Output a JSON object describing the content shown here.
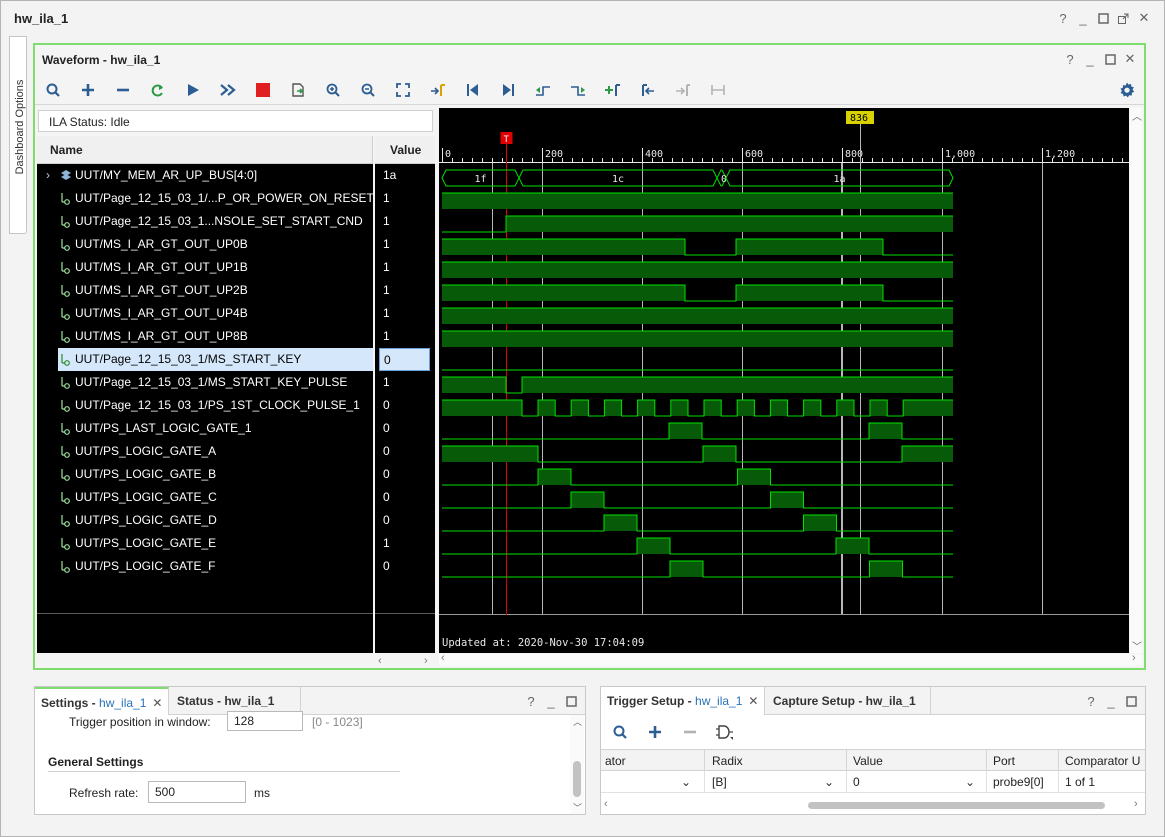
{
  "window": {
    "title": "hw_ila_1"
  },
  "side_tab": {
    "label": "Dashboard Options"
  },
  "waveform": {
    "title": "Waveform - hw_ila_1",
    "ila_status": "ILA Status: Idle",
    "col_name": "Name",
    "col_value": "Value",
    "updated": "Updated at: 2020-Nov-30 17:04:09",
    "cursor_label": "836",
    "trigger_marker": "T",
    "ticks": [
      "0",
      "200",
      "400",
      "600",
      "800",
      "1,000",
      "1,200"
    ],
    "bus_segments": [
      "1f",
      "1c",
      "0",
      "1a"
    ],
    "signals": [
      {
        "name": "UUT/MY_MEM_AR_UP_BUS[4:0]",
        "value": "1a",
        "kind": "bus"
      },
      {
        "name": "UUT/Page_12_15_03_1/...P_OR_POWER_ON_RESET",
        "value": "1",
        "kind": "bit"
      },
      {
        "name": "UUT/Page_12_15_03_1...NSOLE_SET_START_CND",
        "value": "1",
        "kind": "bit"
      },
      {
        "name": "UUT/MS_I_AR_GT_OUT_UP0B",
        "value": "1",
        "kind": "bit"
      },
      {
        "name": "UUT/MS_I_AR_GT_OUT_UP1B",
        "value": "1",
        "kind": "bit"
      },
      {
        "name": "UUT/MS_I_AR_GT_OUT_UP2B",
        "value": "1",
        "kind": "bit"
      },
      {
        "name": "UUT/MS_I_AR_GT_OUT_UP4B",
        "value": "1",
        "kind": "bit"
      },
      {
        "name": "UUT/MS_I_AR_GT_OUT_UP8B",
        "value": "1",
        "kind": "bit"
      },
      {
        "name": "UUT/Page_12_15_03_1/MS_START_KEY",
        "value": "0",
        "kind": "bit",
        "selected": true
      },
      {
        "name": "UUT/Page_12_15_03_1/MS_START_KEY_PULSE",
        "value": "1",
        "kind": "bit"
      },
      {
        "name": "UUT/Page_12_15_03_1/PS_1ST_CLOCK_PULSE_1",
        "value": "0",
        "kind": "bit"
      },
      {
        "name": "UUT/PS_LAST_LOGIC_GATE_1",
        "value": "0",
        "kind": "bit"
      },
      {
        "name": "UUT/PS_LOGIC_GATE_A",
        "value": "0",
        "kind": "bit"
      },
      {
        "name": "UUT/PS_LOGIC_GATE_B",
        "value": "0",
        "kind": "bit"
      },
      {
        "name": "UUT/PS_LOGIC_GATE_C",
        "value": "0",
        "kind": "bit"
      },
      {
        "name": "UUT/PS_LOGIC_GATE_D",
        "value": "0",
        "kind": "bit"
      },
      {
        "name": "UUT/PS_LOGIC_GATE_E",
        "value": "1",
        "kind": "bit"
      },
      {
        "name": "UUT/PS_LOGIC_GATE_F",
        "value": "0",
        "kind": "bit"
      }
    ]
  },
  "settings": {
    "tab_settings": "Settings - ",
    "tab_settings_link": "hw_ila_1",
    "tab_status": "Status - hw_ila_1",
    "trigger_pos_label": "Trigger position in window:",
    "trigger_pos_value": "128",
    "trigger_pos_range": "[0 - 1023]",
    "general_heading": "General Settings",
    "refresh_label": "Refresh rate:",
    "refresh_value": "500",
    "refresh_unit": "ms"
  },
  "trigger": {
    "tab_trigger": "Trigger Setup - ",
    "tab_trigger_link": "hw_ila_1",
    "tab_capture": "Capture Setup - hw_ila_1",
    "columns": [
      "ator",
      "Radix",
      "Value",
      "Port",
      "Comparator U"
    ],
    "row": {
      "radix": "[B]",
      "value": "0",
      "port": "probe9[0]",
      "comparator": "1 of 1"
    }
  },
  "colors": {
    "accent_green": "#7fdc6f",
    "wave_green": "#00e000",
    "wave_fill": "#075a07",
    "link_blue": "#2672b8",
    "marker_red": "#e00000",
    "cursor_yellow": "#d9d200"
  }
}
